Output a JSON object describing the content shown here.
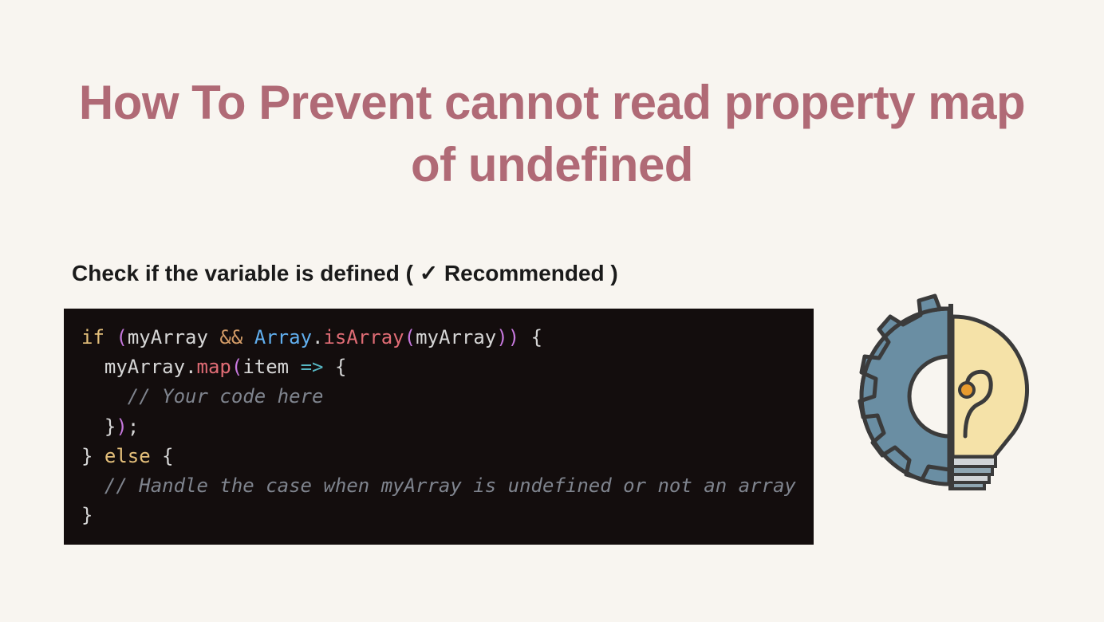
{
  "title": "How To Prevent cannot read property map of undefined",
  "subtitle_prefix": "Check if the variable is defined ( ",
  "subtitle_check": "✓",
  "subtitle_suffix": "  Recommended )",
  "code": {
    "l1": {
      "if": "if",
      "sp1": " ",
      "p1": "(",
      "id1": "myArray",
      "sp2": " ",
      "op1": "&&",
      "sp3": " ",
      "typ": "Array",
      "dot": ".",
      "meth": "isArray",
      "p2": "(",
      "id2": "myArray",
      "p3": ")",
      "p4": ")",
      "sp4": " ",
      "br": "{"
    },
    "l2": {
      "indent": "  ",
      "id": "myArray",
      "dot": ".",
      "meth": "map",
      "p1": "(",
      "param": "item",
      "sp": " ",
      "arrow": "=>",
      "sp2": " ",
      "br": "{"
    },
    "l3": {
      "indent": "    ",
      "comment": "// Your code here"
    },
    "l4": {
      "indent": "  ",
      "br": "}",
      "p": ")",
      "semi": ";"
    },
    "l5": {
      "br1": "}",
      "sp": " ",
      "else": "else",
      "sp2": " ",
      "br2": "{"
    },
    "l6": {
      "indent": "  ",
      "comment": "// Handle the case when myArray is undefined or not an array"
    },
    "l7": {
      "br": "}"
    }
  },
  "illustration": {
    "name": "gear-lightbulb-icon"
  }
}
